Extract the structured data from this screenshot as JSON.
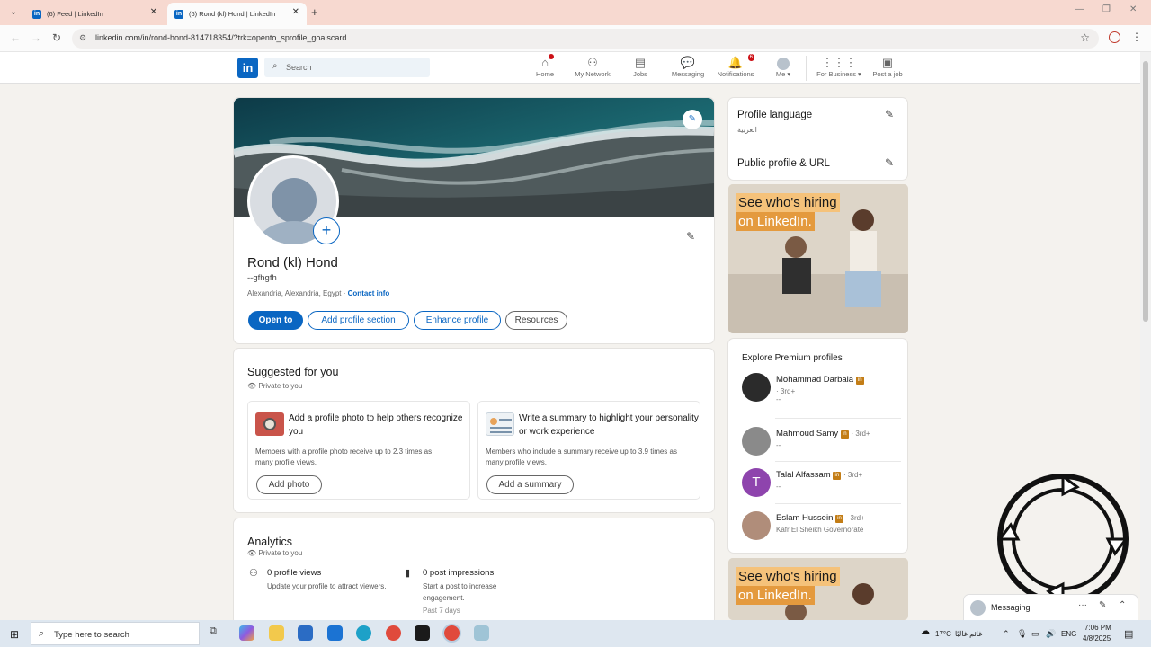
{
  "browser": {
    "tabs": [
      {
        "title": "(6) Feed | LinkedIn",
        "active": false
      },
      {
        "title": "(6) Rond (kl) Hond | LinkedIn",
        "active": true
      }
    ],
    "url": "linkedin.com/in/rond-hond-814718354/?trk=opento_sprofile_goalscard"
  },
  "nav": {
    "search_placeholder": "Search",
    "items": [
      {
        "label": "Home",
        "icon": "home-icon",
        "badge": ""
      },
      {
        "label": "My Network",
        "icon": "network-icon",
        "badge": ""
      },
      {
        "label": "Jobs",
        "icon": "jobs-icon",
        "badge": ""
      },
      {
        "label": "Messaging",
        "icon": "messaging-icon",
        "badge": ""
      },
      {
        "label": "Notifications",
        "icon": "bell-icon",
        "badge": "6"
      },
      {
        "label": "Me",
        "icon": "avatar",
        "badge": ""
      },
      {
        "label": "For Business",
        "icon": "grid-icon",
        "badge": ""
      },
      {
        "label": "Post a job",
        "icon": "briefcase-icon",
        "badge": ""
      }
    ]
  },
  "profile": {
    "name": "Rond (kl) Hond",
    "headline": "--gfhgfh",
    "location": "Alexandria, Alexandria, Egypt ·",
    "contact_info": "Contact info",
    "buttons": {
      "open_to": "Open to",
      "add_section": "Add profile section",
      "enhance": "Enhance profile",
      "resources": "Resources"
    }
  },
  "suggested": {
    "title": "Suggested for you",
    "privacy": "Private to you",
    "cards": [
      {
        "title": "Add a profile photo to help others recognize you",
        "desc": "Members with a profile photo receive up to 2.3 times as many profile views.",
        "button": "Add photo"
      },
      {
        "title": "Write a summary to highlight your personality or work experience",
        "desc": "Members who include a summary receive up to 3.9 times as many profile views.",
        "button": "Add a summary"
      }
    ]
  },
  "analytics": {
    "title": "Analytics",
    "privacy": "Private to you",
    "items": [
      {
        "title": "0 profile views",
        "desc": "Update your profile to attract viewers.",
        "extra": ""
      },
      {
        "title": "0 post impressions",
        "desc": "Start a post to increase engagement.",
        "extra": "Past 7 days"
      }
    ]
  },
  "sidebar": {
    "profile_language": "Profile language",
    "language_value": "العربية",
    "public_profile": "Public profile & URL",
    "ad": {
      "line1": "See who's hiring",
      "line2": "on LinkedIn."
    },
    "premium_title": "Explore Premium profiles",
    "premium_profiles": [
      {
        "name": "Mohammad Darbala",
        "degree": "· 3rd+",
        "sub": "--",
        "color": "#2b2b2b"
      },
      {
        "name": "Mahmoud Samy",
        "degree": "· 3rd+",
        "sub": "--",
        "color": "#8a8a8a"
      },
      {
        "name": "Talal Alfassam",
        "degree": "· 3rd+",
        "sub": "--",
        "color": "#8e44ad",
        "initial": "T"
      },
      {
        "name": "Eslam Hussein",
        "degree": "· 3rd+",
        "sub": "Kafr El Sheikh Governorate",
        "color": "#b08d7a"
      }
    ]
  },
  "messaging_dock": {
    "label": "Messaging"
  },
  "taskbar": {
    "search_placeholder": "Type here to search",
    "weather": "17°C",
    "weather_text": "غائم غالبًا",
    "lang": "ENG",
    "time": "7:06 PM",
    "date": "4/8/2025"
  },
  "colors": {
    "brand": "#0a66c2",
    "premium": "#c37d16",
    "ad_highlight": "#f5c27a"
  }
}
